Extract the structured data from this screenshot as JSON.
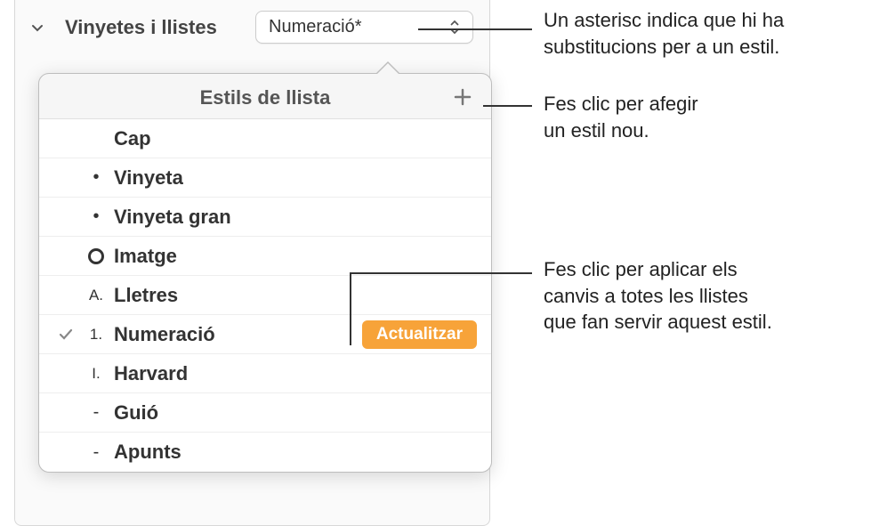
{
  "header": {
    "section_title": "Vinyetes i llistes",
    "dropdown_value": "Numeració*"
  },
  "popover": {
    "title": "Estils de llista",
    "items": [
      {
        "bullet": "",
        "label": "Cap"
      },
      {
        "bullet": "•",
        "label": "Vinyeta"
      },
      {
        "bullet": "•",
        "label": "Vinyeta gran"
      },
      {
        "bullet": "ring",
        "label": "Imatge"
      },
      {
        "bullet": "A.",
        "label": "Lletres"
      },
      {
        "bullet": "1.",
        "label": "Numeració",
        "checked": true,
        "update": true
      },
      {
        "bullet": "I.",
        "label": "Harvard"
      },
      {
        "bullet": "-",
        "label": "Guió"
      },
      {
        "bullet": "-",
        "label": "Apunts"
      }
    ],
    "update_label": "Actualitzar"
  },
  "callouts": {
    "c1": "Un asterisc indica que hi ha substitucions per a un estil.",
    "c2a": "Fes clic per afegir",
    "c2b": "un estil nou.",
    "c3a": "Fes clic per aplicar els",
    "c3b": "canvis a totes les llistes",
    "c3c": "que fan servir aquest estil."
  }
}
